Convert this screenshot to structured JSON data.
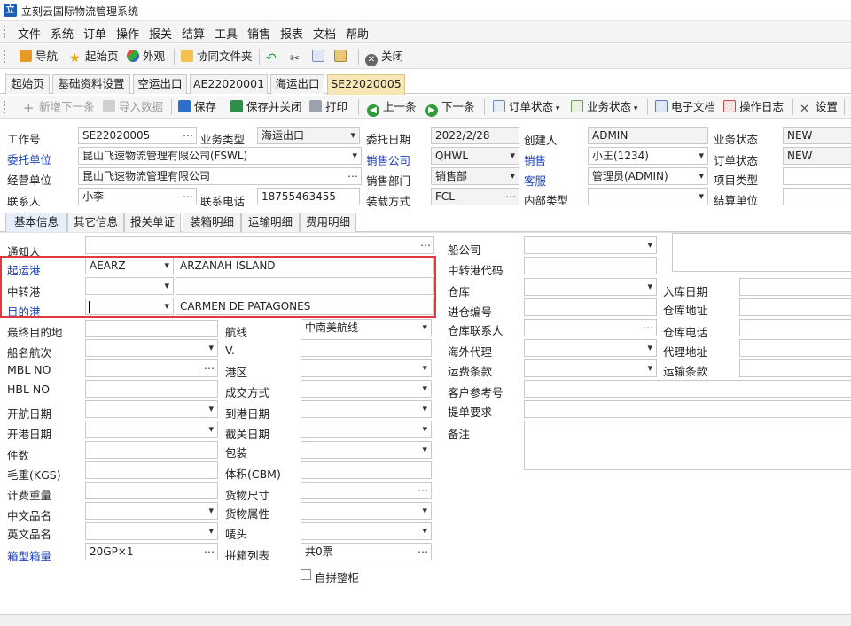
{
  "app": {
    "title": "立刻云国际物流管理系统",
    "icon": "app-icon"
  },
  "menu": [
    "文件",
    "系统",
    "订单",
    "操作",
    "报关",
    "结算",
    "工具",
    "销售",
    "报表",
    "文档",
    "帮助"
  ],
  "toolbar": {
    "nav": "导航",
    "home": "起始页",
    "appearance": "外观",
    "shared_folder": "协同文件夹",
    "close": "关闭"
  },
  "doc_tabs": [
    "起始页",
    "基础资料设置",
    "空运出口",
    "AE22020001",
    "海运出口",
    "SE22020005"
  ],
  "record_toolbar": {
    "add_next": "新增下一条",
    "import": "导入数据",
    "save": "保存",
    "save_close": "保存并关闭",
    "print": "打印",
    "prev": "上一条",
    "next": "下一条",
    "order_status": "订单状态",
    "biz_status": "业务状态",
    "edoc": "电子文档",
    "oplog": "操作日志",
    "settings": "设置"
  },
  "header": {
    "job_no_label": "工作号",
    "job_no": "SE22020005",
    "biz_type_label": "业务类型",
    "biz_type": "海运出口",
    "entrust_date_label": "委托日期",
    "entrust_date": "2022/2/28",
    "creator_label": "创建人",
    "creator": "ADMIN",
    "biz_status_label": "业务状态",
    "biz_status": "NEW",
    "client_label": "委托单位",
    "client": "昆山飞速物流管理有限公司(FSWL)",
    "sales_company_label": "销售公司",
    "sales_company": "QHWL",
    "sales_label": "销售",
    "sales": "小王(1234)",
    "order_status_label": "订单状态",
    "order_status": "NEW",
    "operator_label": "经营单位",
    "operator": "昆山飞速物流管理有限公司",
    "sales_dept_label": "销售部门",
    "sales_dept": "销售部",
    "cs_label": "客服",
    "cs": "管理员(ADMIN)",
    "project_type_label": "项目类型",
    "project_type": "",
    "contact_label": "联系人",
    "contact": "小李",
    "phone_label": "联系电话",
    "phone": "18755463455",
    "load_mode_label": "装载方式",
    "load_mode": "FCL",
    "internal_type_label": "内部类型",
    "internal_type": "",
    "settle_unit_label": "结算单位",
    "settle_unit": ""
  },
  "sub_tabs": [
    "基本信息",
    "其它信息",
    "报关单证",
    "装箱明细",
    "运输明细",
    "费用明细"
  ],
  "form": {
    "notify_label": "通知人",
    "notify": "",
    "pol_label": "起运港",
    "pol_code": "AEARZ",
    "pol_name": "ARZANAH ISLAND",
    "transit_label": "中转港",
    "transit_code": "",
    "transit_name": "",
    "pod_label": "目的港",
    "pod_code": "",
    "pod_name": "CARMEN DE PATAGONES",
    "final_dest_label": "最终目的地",
    "final_dest": "",
    "route_label": "航线",
    "route": "中南美航线",
    "vessel_label": "船名航次",
    "vessel": "",
    "v_label": "V.",
    "v": "",
    "mbl_label": "MBL NO",
    "mbl": "",
    "port_area_label": "港区",
    "port_area": "",
    "hbl_label": "HBL NO",
    "hbl": "",
    "deal_label": "成交方式",
    "deal": "",
    "sail_date_label": "开航日期",
    "sail_date": "",
    "arrival_label": "到港日期",
    "arrival": "",
    "open_date_label": "开港日期",
    "open_date": "",
    "cutoff_label": "截关日期",
    "cutoff": "",
    "pieces_label": "件数",
    "pieces": "",
    "packing_label": "包装",
    "packing": "",
    "gross_label": "毛重(KGS)",
    "gross": "",
    "volume_label": "体积(CBM)",
    "volume": "",
    "charge_wt_label": "计费重量",
    "charge_wt": "",
    "size_label": "货物尺寸",
    "size": "",
    "cn_name_label": "中文品名",
    "cn_name": "",
    "attr_label": "货物属性",
    "attr": "",
    "en_name_label": "英文品名",
    "en_name": "",
    "mark_label": "唛头",
    "mark": "",
    "container_label": "箱型箱量",
    "container": "20GP×1",
    "consol_label": "拼箱列表",
    "consol": "共0票",
    "self_consol_label": "自拼整柜",
    "carrier_label": "船公司",
    "carrier": "",
    "transit_code_label": "中转港代码",
    "transit_code2": "",
    "warehouse_label": "仓库",
    "warehouse": "",
    "in_date_label": "入库日期",
    "in_date": "",
    "wh_no_label": "进仓编号",
    "wh_no": "",
    "wh_addr_label": "仓库地址",
    "wh_addr": "",
    "wh_contact_label": "仓库联系人",
    "wh_contact": "",
    "wh_phone_label": "仓库电话",
    "wh_phone": "",
    "agent_label": "海外代理",
    "agent": "",
    "agent_addr_label": "代理地址",
    "agent_addr": "",
    "freight_label": "运费条款",
    "freight": "",
    "transport_label": "运输条款",
    "transport": "",
    "cust_ref_label": "客户参考号",
    "cust_ref": "",
    "bl_req_label": "提单要求",
    "bl_req": "",
    "remark_label": "备注",
    "remark": ""
  },
  "colors": {
    "accent_tab": "#f7e7b5",
    "link": "#1a3fb8",
    "highlight_box": "#e0393e"
  }
}
